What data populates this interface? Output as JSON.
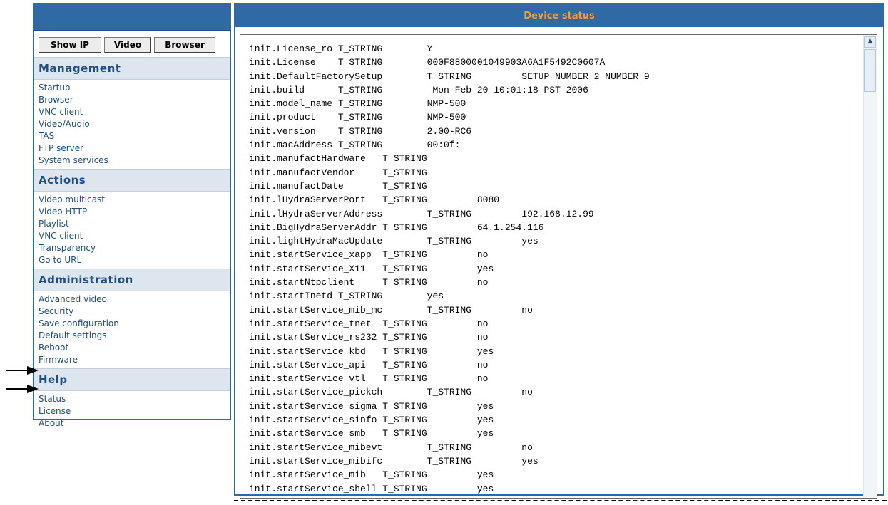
{
  "top_buttons": [
    {
      "label": "Show IP"
    },
    {
      "label": "Video"
    },
    {
      "label": "Browser"
    }
  ],
  "sections": [
    {
      "title": "Management",
      "items": [
        "Startup",
        "Browser",
        "VNC client",
        "Video/Audio",
        "TAS",
        "FTP server",
        "System services"
      ]
    },
    {
      "title": "Actions",
      "items": [
        "Video multicast",
        "Video HTTP",
        "Playlist",
        "VNC client",
        "Transparency",
        "Go to URL"
      ]
    },
    {
      "title": "Administration",
      "items": [
        "Advanced video",
        "Security",
        "Save configuration",
        "Default settings",
        "Reboot",
        "Firmware"
      ]
    },
    {
      "title": "Help",
      "items": [
        "Status",
        "License",
        "About"
      ]
    }
  ],
  "main": {
    "title": "Device status",
    "lines": [
      "init.License_ro T_STRING        Y",
      "init.License    T_STRING        000F8800001049903A6A1F5492C0607A",
      "init.DefaultFactorySetup        T_STRING         SETUP NUMBER_2 NUMBER_9",
      "init.build      T_STRING         Mon Feb 20 10:01:18 PST 2006",
      "init.model_name T_STRING        NMP-500",
      "init.product    T_STRING        NMP-500",
      "init.version    T_STRING        2.00-RC6",
      "init.macAddress T_STRING        00:0f:",
      "init.manufactHardware   T_STRING",
      "init.manufactVendor     T_STRING",
      "init.manufactDate       T_STRING",
      "init.lHydraServerPort   T_STRING         8080",
      "init.lHydraServerAddress        T_STRING         192.168.12.99",
      "init.BigHydraServerAddr T_STRING         64.1.254.116",
      "init.lightHydraMacUpdate        T_STRING         yes",
      "init.startService_xapp  T_STRING         no",
      "init.startService_X11   T_STRING         yes",
      "init.startNtpclient     T_STRING         no",
      "init.startInetd T_STRING        yes",
      "init.startService_mib_mc        T_STRING         no",
      "init.startService_tnet  T_STRING         no",
      "init.startService_rs232 T_STRING         no",
      "init.startService_kbd   T_STRING         yes",
      "init.startService_api   T_STRING         no",
      "init.startService_vtl   T_STRING         no",
      "init.startService_pickch        T_STRING         no",
      "init.startService_sigma T_STRING         yes",
      "init.startService_sinfo T_STRING         yes",
      "init.startService_smb   T_STRING         yes",
      "init.startService_mibevt        T_STRING         no",
      "init.startService_mibifc        T_STRING         yes",
      "init.startService_mib   T_STRING         yes",
      "init.startService_shell T_STRING         yes"
    ]
  },
  "colors": {
    "header_blue": "#2f6aa4",
    "title_orange": "#ff9a2e",
    "link_blue": "#1f4f80"
  }
}
